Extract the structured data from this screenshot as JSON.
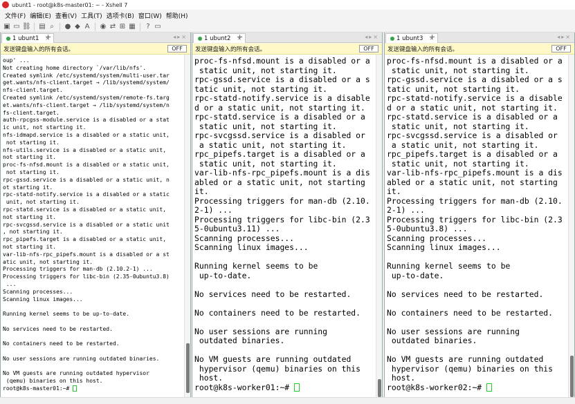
{
  "window": {
    "title": "ubunt1 - root@k8s-master01: ~ - Xshell 7"
  },
  "menu": [
    "文件(F)",
    "编辑(E)",
    "查看(V)",
    "工具(T)",
    "选项卡(B)",
    "窗口(W)",
    "帮助(H)"
  ],
  "broadcast": {
    "text": "发送键盘输入的所有会话。",
    "toggle": "OFF"
  },
  "panes": [
    {
      "tab": "1 ubunt1",
      "lines": [
        "oup' ...",
        "Not creating home directory `/var/lib/nfs'.",
        "Created symlink /etc/systemd/system/multi-user.tar",
        "get.wants/nfs-client.target → /lib/systemd/system/",
        "nfs-client.target.",
        "Created symlink /etc/systemd/system/remote-fs.targ",
        "et.wants/nfs-client.target → /lib/systemd/system/n",
        "fs-client.target.",
        "auth-rpcgss-module.service is a disabled or a stat",
        "ic unit, not starting it.",
        "nfs-idmapd.service is a disabled or a static unit,",
        " not starting it.",
        "nfs-utils.service is a disabled or a static unit, ",
        "not starting it.",
        "proc-fs-nfsd.mount is a disabled or a static unit,",
        " not starting it.",
        "rpc-gssd.service is a disabled or a static unit, n",
        "ot starting it.",
        "rpc-statd-notify.service is a disabled or a static",
        " unit, not starting it.",
        "rpc-statd.service is a disabled or a static unit, ",
        "not starting it.",
        "rpc-svcgssd.service is a disabled or a static unit",
        ", not starting it.",
        "rpc_pipefs.target is a disabled or a static unit, ",
        "not starting it.",
        "var-lib-nfs-rpc_pipefs.mount is a disabled or a st",
        "atic unit, not starting it.",
        "Processing triggers for man-db (2.10.2-1) ...",
        "Processing triggers for libc-bin (2.35-0ubuntu3.8)",
        " ...",
        "Scanning processes...",
        "Scanning linux images...",
        "",
        "Running kernel seems to be up-to-date.",
        "",
        "No services need to be restarted.",
        "",
        "No containers need to be restarted.",
        "",
        "No user sessions are running outdated binaries.",
        "",
        "No VM guests are running outdated hypervisor",
        " (qemu) binaries on this host."
      ],
      "prompt": "root@k8s-master01:~# "
    },
    {
      "tab": "1 ubunt2",
      "lines": [
        "proc-fs-nfsd.mount is a disabled or a",
        " static unit, not starting it.",
        "rpc-gssd.service is a disabled or a s",
        "tatic unit, not starting it.",
        "rpc-statd-notify.service is a disable",
        "d or a static unit, not starting it.",
        "rpc-statd.service is a disabled or a",
        " static unit, not starting it.",
        "rpc-svcgssd.service is a disabled or",
        " a static unit, not starting it.",
        "rpc_pipefs.target is a disabled or a",
        " static unit, not starting it.",
        "var-lib-nfs-rpc_pipefs.mount is a dis",
        "abled or a static unit, not starting",
        "it.",
        "Processing triggers for man-db (2.10.",
        "2-1) ...",
        "Processing triggers for libc-bin (2.3",
        "5-0ubuntu3.11) ...",
        "Scanning processes...",
        "Scanning linux images...",
        "",
        "Running kernel seems to be",
        " up-to-date.",
        "",
        "No services need to be restarted.",
        "",
        "No containers need to be restarted.",
        "",
        "No user sessions are running",
        " outdated binaries.",
        "",
        "No VM guests are running outdated",
        " hypervisor (qemu) binaries on this",
        " host."
      ],
      "prompt": "root@k8s-worker01:~# "
    },
    {
      "tab": "1 ubunt3",
      "lines": [
        "proc-fs-nfsd.mount is a disabled or a",
        " static unit, not starting it.",
        "rpc-gssd.service is a disabled or a s",
        "tatic unit, not starting it.",
        "rpc-statd-notify.service is a disable",
        "d or a static unit, not starting it.",
        "rpc-statd.service is a disabled or a",
        " static unit, not starting it.",
        "rpc-svcgssd.service is a disabled or",
        " a static unit, not starting it.",
        "rpc_pipefs.target is a disabled or a",
        " static unit, not starting it.",
        "var-lib-nfs-rpc_pipefs.mount is a dis",
        "abled or a static unit, not starting",
        "it.",
        "Processing triggers for man-db (2.10.",
        "2-1) ...",
        "Processing triggers for libc-bin (2.3",
        "5-0ubuntu3.8) ...",
        "Scanning processes...",
        "Scanning linux images...",
        "",
        "Running kernel seems to be",
        " up-to-date.",
        "",
        "No services need to be restarted.",
        "",
        "No containers need to be restarted.",
        "",
        "No user sessions are running",
        " outdated binaries.",
        "",
        "No VM guests are running outdated",
        " hypervisor (qemu) binaries on this",
        " host."
      ],
      "prompt": "root@k8s-worker02:~# "
    }
  ],
  "icons": [
    "new-session-icon",
    "folder-icon",
    "link-icon",
    "properties-icon",
    "search-icon",
    "globe-icon",
    "color-icon",
    "font-icon",
    "xftp-icon",
    "sftp-icon",
    "split-icon",
    "layout-icon",
    "help-icon",
    "chat-icon"
  ],
  "colors": {
    "broadcast_bg": "#fff9c8",
    "tab_dot": "#3aa34a",
    "cursor": "#26c826",
    "app_icon": "#d62a2a"
  }
}
